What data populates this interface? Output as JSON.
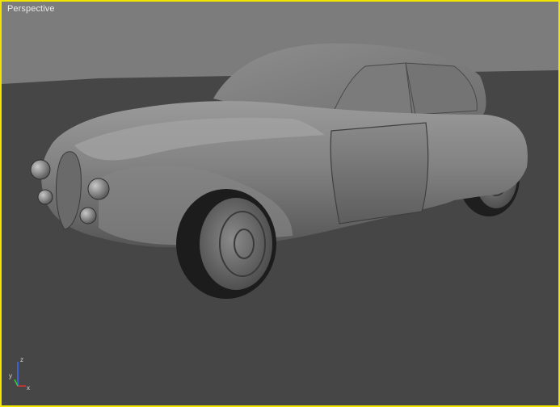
{
  "viewport": {
    "label": "Perspective",
    "border_color": "#f2e600",
    "active": true
  },
  "axis_gizmo": {
    "labels": {
      "x": "x",
      "y": "y",
      "z": "z"
    },
    "colors": {
      "x": "#e03030",
      "y": "#30d030",
      "z": "#3a6cff"
    }
  },
  "scene": {
    "object": "car-model",
    "shading": "gray-smooth",
    "background_color": "#7c7c7c",
    "ground_color": "#464646"
  }
}
